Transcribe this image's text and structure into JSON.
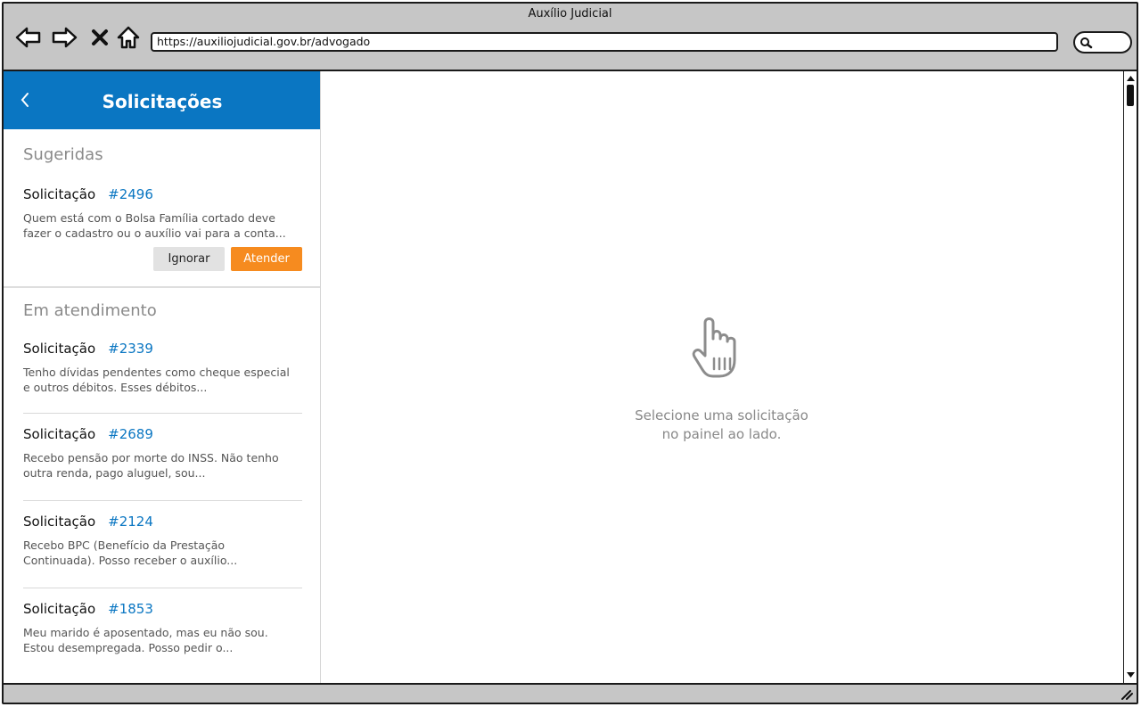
{
  "window": {
    "title": "Auxílio Judicial",
    "url": "https://auxiliojudicial.gov.br/advogado"
  },
  "sidebar": {
    "title": "Solicitações",
    "suggested_label": "Sugeridas",
    "suggested": {
      "label": "Solicitação",
      "id": "#2496",
      "desc_line1": "Quem está com o Bolsa Família cortado deve",
      "desc_line2": "fazer o cadastro ou o auxílio vai para a conta..."
    },
    "buttons": {
      "ignore": "Ignorar",
      "attend": "Atender"
    },
    "in_progress_label": "Em atendimento",
    "in_progress": [
      {
        "label": "Solicitação",
        "id": "#2339",
        "desc_line1": "Tenho dívidas pendentes como cheque especial",
        "desc_line2": "e outros débitos. Esses débitos..."
      },
      {
        "label": "Solicitação",
        "id": "#2689",
        "desc_line1": "Recebo pensão por morte do INSS. Não tenho",
        "desc_line2": "outra renda, pago aluguel, sou..."
      },
      {
        "label": "Solicitação",
        "id": "#2124",
        "desc_line1": "Recebo BPC (Benefício da Prestação",
        "desc_line2": "Continuada). Posso receber o auxílio..."
      },
      {
        "label": "Solicitação",
        "id": "#1853",
        "desc_line1": "Meu marido é aposentado, mas eu não sou.",
        "desc_line2": "Estou desempregada. Posso pedir o..."
      }
    ]
  },
  "main": {
    "empty_line1": "Selecione uma solicitação",
    "empty_line2": "no painel ao lado."
  },
  "colors": {
    "header_blue": "#0a76c2",
    "attend_orange": "#f68b1f",
    "id_blue": "#0a76c2"
  },
  "icons": [
    "back-arrow-icon",
    "forward-arrow-icon",
    "close-icon",
    "home-icon",
    "search-icon",
    "chevron-left-icon",
    "pointer-hand-icon",
    "resize-grip-icon"
  ]
}
